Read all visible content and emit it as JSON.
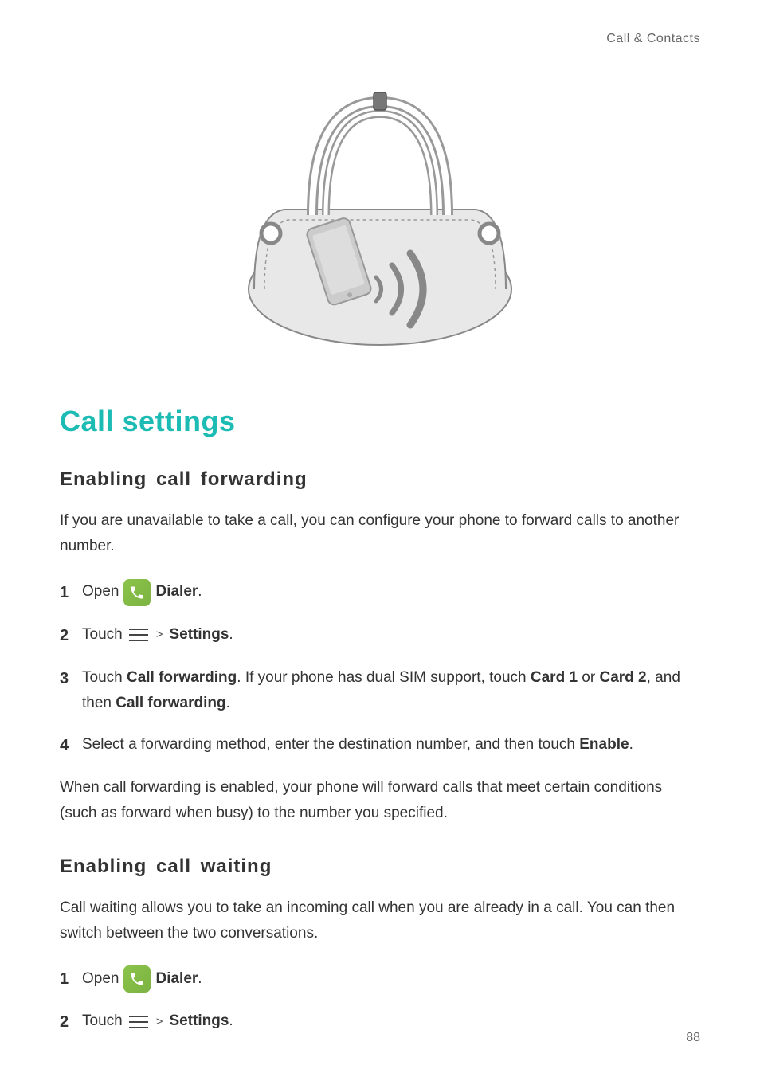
{
  "breadcrumb": "Call & Contacts",
  "page_title": "Call settings",
  "section1": {
    "heading": "Enabling  call  forwarding",
    "intro": "If you are unavailable to take a call, you can configure your phone to forward calls to another number.",
    "steps": {
      "s1": {
        "num": "1",
        "pre": "Open",
        "bold": "Dialer",
        "post": "."
      },
      "s2": {
        "num": "2",
        "pre": "Touch",
        "gt": ">",
        "bold": "Settings",
        "post": "."
      },
      "s3": {
        "num": "3",
        "p1": "Touch ",
        "b1": "Call forwarding",
        "p2": ". If your phone has dual SIM support, touch ",
        "b2": "Card 1",
        "p3": " or ",
        "b3": "Card 2",
        "p4": ", and then ",
        "b4": "Call forwarding",
        "p5": "."
      },
      "s4": {
        "num": "4",
        "p1": "Select a forwarding method, enter the destination number, and then touch ",
        "b1": "Enable",
        "p2": "."
      }
    },
    "after": "When call forwarding is enabled, your phone will forward calls that meet certain conditions (such as forward when busy) to the number you specified."
  },
  "section2": {
    "heading": "Enabling  call  waiting",
    "intro": "Call waiting allows you to take an incoming call when you are already in a call. You can then switch between the two conversations.",
    "steps": {
      "s1": {
        "num": "1",
        "pre": "Open",
        "bold": "Dialer",
        "post": "."
      },
      "s2": {
        "num": "2",
        "pre": "Touch",
        "gt": ">",
        "bold": "Settings",
        "post": "."
      }
    }
  },
  "icons": {
    "dialer": "dialer-icon",
    "menu": "menu-icon"
  },
  "page_number": "88"
}
